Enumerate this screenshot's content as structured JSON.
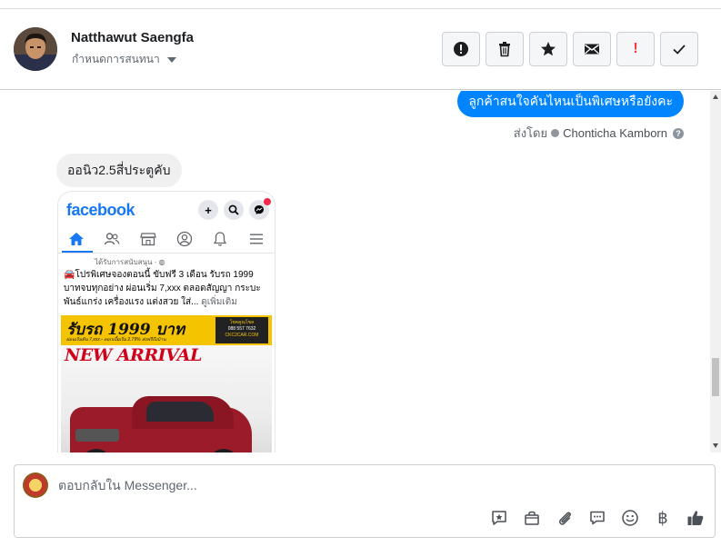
{
  "header": {
    "contact_name": "Natthawut Saengfa",
    "assign_label": "กำหนดการสนทนา",
    "actions": [
      {
        "name": "mark-spam-icon",
        "label": ""
      },
      {
        "name": "trash-icon",
        "label": ""
      },
      {
        "name": "star-icon",
        "label": ""
      },
      {
        "name": "envelope-icon",
        "label": ""
      },
      {
        "name": "follow-up-icon",
        "label": "!"
      },
      {
        "name": "check-icon",
        "label": ""
      }
    ]
  },
  "conversation": {
    "outgoing_message": "ลูกค้าสนใจคันไหนเป็นพิเศษหรือยังคะ",
    "sent_by_prefix": "ส่งโดย",
    "sent_by_agent": "Chonticha Kamborn",
    "help_glyph": "?",
    "incoming_message": "ออนิว2.5สี่ประตูคับ",
    "shared_image": {
      "app_logo": "facebook",
      "plus_glyph": "+",
      "sponsored": "ได้รับการสนับสนุน · ",
      "post_text": "🚘โปรพิเศษจองตอนนี้ ขับฟรี 3 เดือน รับรถ 1999 บาทจบทุกอย่าง ผ่อนเริ่ม 7,xxx ตลอดสัญญา กระบะพันธ์แกร่ง เครื่องแรง แต่งสวย ใส่...",
      "see_more": "ดูเพิ่มเติม",
      "banner_headline": "รับรถ 1999 บาท",
      "banner_sub": "ผ่อนเริ่มต้น 7,xxx.-  ดอกเบี้ยเริ่ม 2.79%  ส่งฟรีถึงบ้าน",
      "dealer_logo_name": "โชคคูณโชค",
      "dealer_phone": "088 557 7632",
      "dealer_site": "CKC2CAR.COM",
      "arrival_text": "NEW ARRIVAL"
    }
  },
  "composer": {
    "placeholder": "ตอบกลับใน Messenger...",
    "tools": [
      "saved-reply-icon",
      "shopping-bag-icon",
      "attachment-icon",
      "chat-bubble-icon",
      "emoji-icon",
      "baht-icon",
      "like-icon"
    ],
    "baht_glyph": "฿"
  }
}
